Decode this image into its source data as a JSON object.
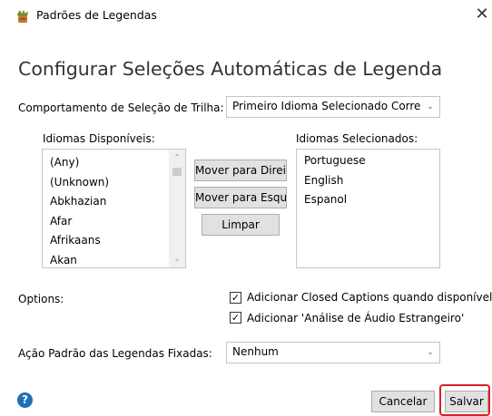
{
  "window": {
    "title": "Padrões de Legendas",
    "close_glyph": "✕",
    "icon": "app-icon"
  },
  "heading": "Configurar Seleções Automáticas de Legenda",
  "track_selection": {
    "label": "Comportamento de Seleção de Trilha:",
    "value": "Primeiro Idioma Selecionado Corre"
  },
  "available": {
    "label": "Idiomas Disponíveis:",
    "items": [
      "(Any)",
      "(Unknown)",
      "Abkhazian",
      "Afar",
      "Afrikaans",
      "Akan"
    ]
  },
  "selected": {
    "label": "Idiomas Selecionados:",
    "items": [
      "Portuguese",
      "English",
      "Espanol"
    ]
  },
  "buttons": {
    "move_right": "Mover para Direi",
    "move_left": "Mover para Esqu",
    "clear": "Limpar",
    "cancel": "Cancelar",
    "save": "Salvar"
  },
  "options": {
    "label": "Options:",
    "checkbox1": {
      "label": "Adicionar Closed Captions quando disponível",
      "checked": true
    },
    "checkbox2": {
      "label": "Adicionar 'Análise de Áudio Estrangeiro'",
      "checked": true
    }
  },
  "fixed_default": {
    "label": "Ação Padrão das Legendas Fixadas:",
    "value": "Nenhum"
  },
  "help": {
    "glyph": "?"
  },
  "check_glyph": "✓",
  "arrow_glyphs": {
    "down": "⌄",
    "up": "⌃"
  },
  "colors": {
    "highlight_border": "#d8202a",
    "help_blue": "#1f6fb8",
    "button_face": "#e1e1e1"
  }
}
